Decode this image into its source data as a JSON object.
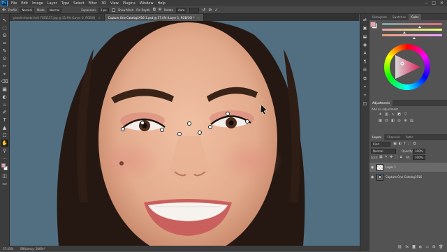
{
  "menubar": {
    "logo": "Ps",
    "items": [
      "File",
      "Edit",
      "Image",
      "Layer",
      "Type",
      "Select",
      "Filter",
      "3D",
      "View",
      "Plugins",
      "Window",
      "Help"
    ],
    "window_controls": [
      "–",
      "□",
      "✕"
    ]
  },
  "optionsbar": {
    "profile_label": "Profile",
    "profile_value": "Normal",
    "mode_label": "Mode",
    "mode_value": "Normal",
    "expansion_label": "Expansion",
    "expansion_value": "1 px",
    "show_mesh_label": "Show Mesh",
    "pin_depth_label": "Pin Depth",
    "rotate_label": "Rotate",
    "rotate_value": "Auto"
  },
  "tabs": [
    {
      "label": "pexels-shvets-forti 7581157.jpg @ 31.6% (Layer 0, RGB/8)",
      "active": false
    },
    {
      "label": "Capture One Catalog1916-1.psd @ 37.4% (Layer 1, RGB/16) *",
      "active": true
    }
  ],
  "tools": [
    "↖",
    "⬚",
    "ʘ",
    "⌗",
    "✎",
    "⊙",
    "✂",
    "⌖",
    "⌫",
    "▣",
    "◐",
    "♨",
    "✐",
    "T",
    "▲",
    "☐",
    "✋",
    "⚲",
    "⋯"
  ],
  "statusbar": {
    "zoom": "37.43%",
    "efficiency": "Efficiency: 100%*"
  },
  "right_strip": [
    "⇄",
    "▣",
    "⬓",
    "◉",
    "A",
    "¶",
    "☰",
    "⧉",
    "⌖",
    "✧",
    "◫"
  ],
  "color_panel": {
    "tabs": [
      "Histogram",
      "Swatches",
      "Color"
    ],
    "active_tab": "Color",
    "foreground": "#e8a3a8",
    "background": "#ffffff"
  },
  "adjustments_panel": {
    "title": "Adjustments",
    "subtitle": "Add an adjustment"
  },
  "layers_panel": {
    "tabs": [
      "Layers",
      "Channels",
      "Paths"
    ],
    "active_tab": "Layers",
    "kind_label": "Kind",
    "blend_mode": "Normal",
    "opacity_label": "Opacity:",
    "opacity_value": "100%",
    "lock_label": "Lock:",
    "fill_label": "Fill:",
    "fill_value": "100%",
    "layers": [
      {
        "name": "Layer 1",
        "selected": true
      },
      {
        "name": "Capture One Catalog1916",
        "selected": false
      }
    ]
  },
  "canvas": {
    "background_color": "#526f82",
    "skin_color": "#e3ab8d",
    "hair_color": "#251812"
  }
}
